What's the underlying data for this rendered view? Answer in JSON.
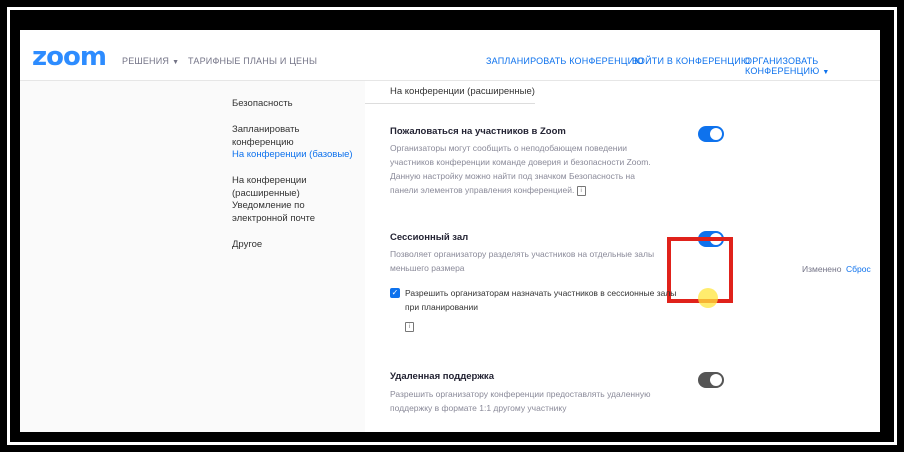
{
  "nav": {
    "logo": "zoom",
    "solutions": "РЕШЕНИЯ",
    "plans": "ТАРИФНЫЕ ПЛАНЫ И ЦЕНЫ",
    "schedule": "ЗАПЛАНИРОВАТЬ КОНФЕРЕНЦИЮ",
    "join": "ВОЙТИ В КОНФЕРЕНЦИЮ",
    "host": "ОРГАНИЗОВАТЬ КОНФЕРЕНЦИЮ"
  },
  "sidebar": {
    "items": [
      {
        "label": "Безопасность"
      },
      {
        "label": "Запланировать конференцию"
      },
      {
        "label": "На конференции (базовые)"
      },
      {
        "label": "На конференции (расширенные)"
      },
      {
        "label": "Уведомление по электронной почте"
      },
      {
        "label": "Другое"
      }
    ]
  },
  "content": {
    "section_header": "На конференции (расширенные)",
    "settings": [
      {
        "title": "Пожаловаться на участников в Zoom",
        "description": "Организаторы могут сообщить о неподобающем поведении участников конференции команде доверия и безопасности Zoom. Данную настройку можно найти под значком Безопасность на панели элементов управления конференцией.",
        "enabled": true
      },
      {
        "title": "Сессионный зал",
        "description": "Позволяет организатору разделять участников на отдельные залы меньшего размера",
        "enabled": true,
        "checkbox_label": "Разрешить организаторам назначать участников в сессионные залы при планировании",
        "checkbox_checked": true,
        "modified": "Изменено",
        "reset": "Сброс"
      },
      {
        "title": "Удаленная поддержка",
        "description": "Разрешить организатору конференции предоставлять удаленную поддержку в формате 1:1 другому участнику",
        "enabled": false
      }
    ]
  },
  "colors": {
    "accent": "#0e72ed",
    "logo": "#2d8cff",
    "highlight": "#e0221b"
  }
}
